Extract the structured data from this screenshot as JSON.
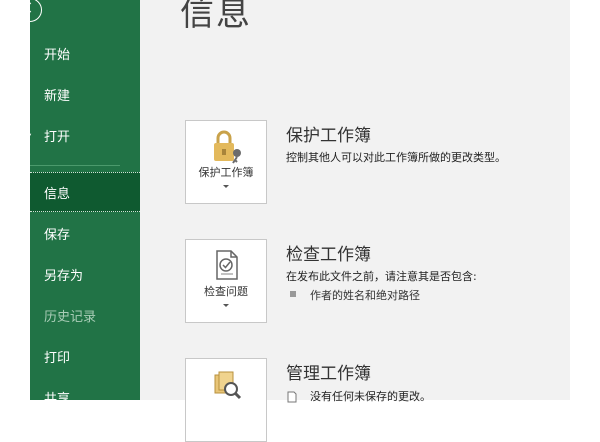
{
  "sidebar": {
    "items": [
      {
        "label": "开始",
        "icon": "home-icon"
      },
      {
        "label": "新建",
        "icon": "new-file-icon"
      },
      {
        "label": "打开",
        "icon": "open-folder-icon"
      },
      {
        "label": "信息",
        "selected": true
      },
      {
        "label": "保存"
      },
      {
        "label": "另存为"
      },
      {
        "label": "历史记录",
        "disabled": true
      },
      {
        "label": "打印"
      },
      {
        "label": "共享"
      }
    ],
    "colors": {
      "background": "#217346",
      "selected": "#0f5a30"
    }
  },
  "main": {
    "title": "信息",
    "sections": [
      {
        "button_label": "保护工作簿",
        "icon": "lock-key-icon",
        "heading": "保护工作簿",
        "description": "控制其他人可以对此工作簿所做的更改类型。"
      },
      {
        "button_label": "检查问题",
        "icon": "inspect-document-icon",
        "heading": "检查工作簿",
        "description": "在发布此文件之前，请注意其是否包含:",
        "bullets": [
          "作者的姓名和绝对路径"
        ]
      },
      {
        "icon": "manage-workbook-icon",
        "heading": "管理工作簿",
        "description": "没有任何未保存的更改。"
      }
    ]
  }
}
